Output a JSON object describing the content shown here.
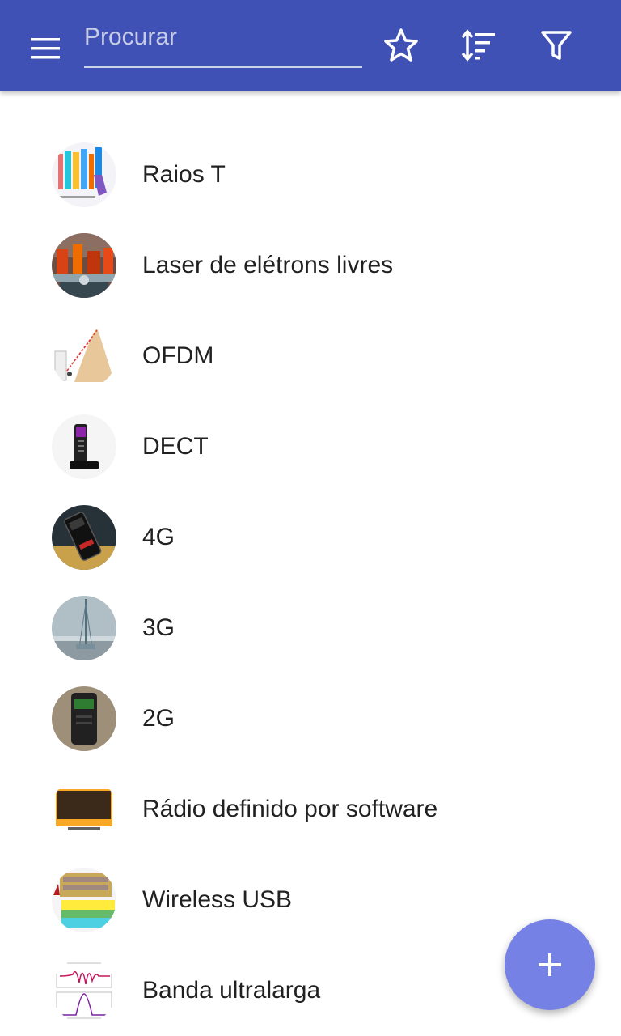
{
  "toolbar": {
    "search_placeholder": "Procurar",
    "icons": [
      "menu-icon",
      "star-icon",
      "sort-icon",
      "filter-icon"
    ],
    "accent_color": "#3f51b5"
  },
  "items": [
    {
      "label": "Raios T"
    },
    {
      "label": "Laser de elétrons livres"
    },
    {
      "label": "OFDM"
    },
    {
      "label": "DECT"
    },
    {
      "label": "4G"
    },
    {
      "label": "3G"
    },
    {
      "label": "2G"
    },
    {
      "label": "Rádio definido por software"
    },
    {
      "label": "Wireless USB"
    },
    {
      "label": "Banda ultralarga"
    }
  ],
  "fab": {
    "icon": "plus-icon",
    "color": "#7681e6"
  }
}
